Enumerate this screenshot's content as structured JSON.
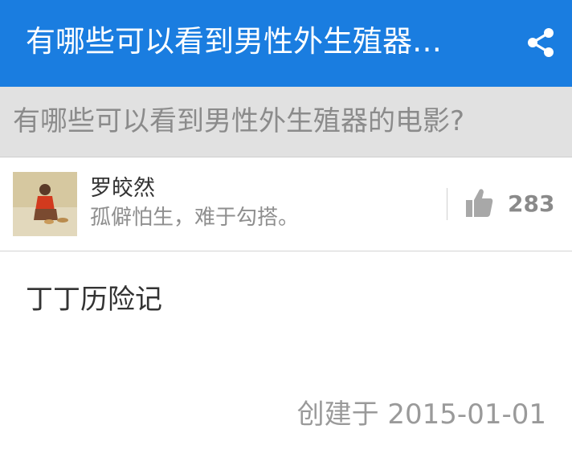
{
  "appbar": {
    "title": "有哪些可以看到男性外生殖器…",
    "share_icon": "share-icon",
    "color": "#1a7de0"
  },
  "question": {
    "title": "有哪些可以看到男性外生殖器的电影?"
  },
  "author": {
    "name": "罗皎然",
    "bio": "孤僻怕生，难于勾搭。",
    "avatar_icon": "avatar-photo"
  },
  "vote": {
    "icon": "thumbs-up-icon",
    "count": "283"
  },
  "answer": {
    "content": "丁丁历险记"
  },
  "meta": {
    "created": "创建于 2015-01-01"
  }
}
